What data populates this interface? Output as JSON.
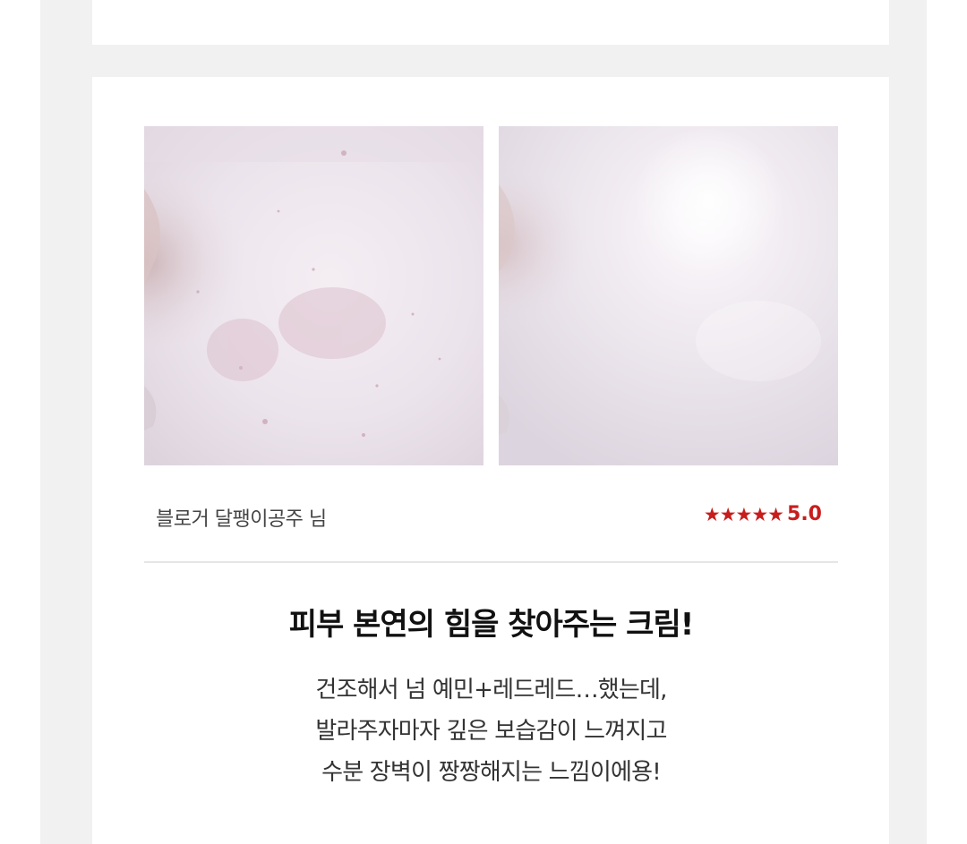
{
  "review": {
    "photos": [
      {
        "name": "before"
      },
      {
        "name": "after"
      }
    ],
    "reviewer": "블로거 달팽이공주 님",
    "rating_stars": "★★★★★",
    "rating_score": "5.0",
    "headline": "피부 본연의 힘을 찾아주는 크림!",
    "body_lines": [
      "건조해서 넘 예민+레드레드…했는데,",
      "발라주자마자 깊은 보습감이 느껴지고",
      "수분 장벽이 짱짱해지는 느낌이에용!"
    ]
  },
  "colors": {
    "accent_red": "#c81d1d",
    "frame_bg": "#f1f1f1"
  }
}
